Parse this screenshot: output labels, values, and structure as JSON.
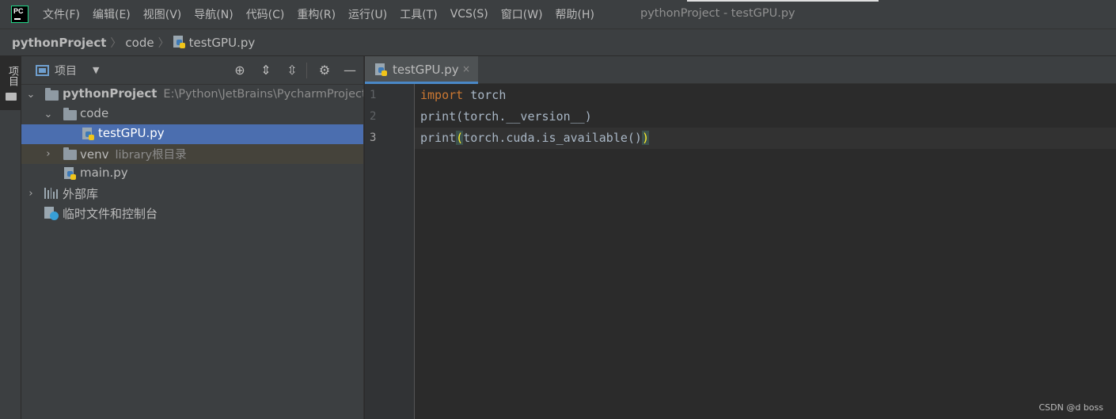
{
  "menubar": {
    "items": [
      "文件(F)",
      "编辑(E)",
      "视图(V)",
      "导航(N)",
      "代码(C)",
      "重构(R)",
      "运行(U)",
      "工具(T)",
      "VCS(S)",
      "窗口(W)",
      "帮助(H)"
    ],
    "window_title": "pythonProject - testGPU.py"
  },
  "breadcrumb": {
    "project": "pythonProject",
    "folder": "code",
    "file": "testGPU.py",
    "separator": "〉"
  },
  "tool_stripe": {
    "project_label": "项目"
  },
  "project_panel": {
    "title": "项目",
    "dropdown": "▼",
    "icons": {
      "locate": "⊕",
      "expand": "⇕",
      "collapse": "⇳",
      "settings": "⚙",
      "hide": "—"
    },
    "tree": {
      "root_name": "pythonProject",
      "root_path": "E:\\Python\\JetBrains\\PycharmProject\\",
      "code_folder": "code",
      "test_file": "testGPU.py",
      "venv_name": "venv",
      "venv_note": "library根目录",
      "main_file": "main.py",
      "ext_libs": "外部库",
      "scratches": "临时文件和控制台"
    }
  },
  "editor": {
    "tab_label": "testGPU.py",
    "tab_close": "×",
    "line_numbers": [
      "1",
      "2",
      "3"
    ],
    "line1_keyword": "import",
    "line1_rest": " torch",
    "line2": "print(torch.__version__)",
    "line3_pre": "print",
    "line3_open": "(",
    "line3_mid": "torch.cuda.is_available()",
    "line3_close": ")"
  },
  "watermark": "CSDN @d boss",
  "colors": {
    "accent_selection": "#4b6eaf",
    "keyword": "#cc7832",
    "default_code": "#a9b7c6",
    "brace_match": "#ffef28"
  }
}
